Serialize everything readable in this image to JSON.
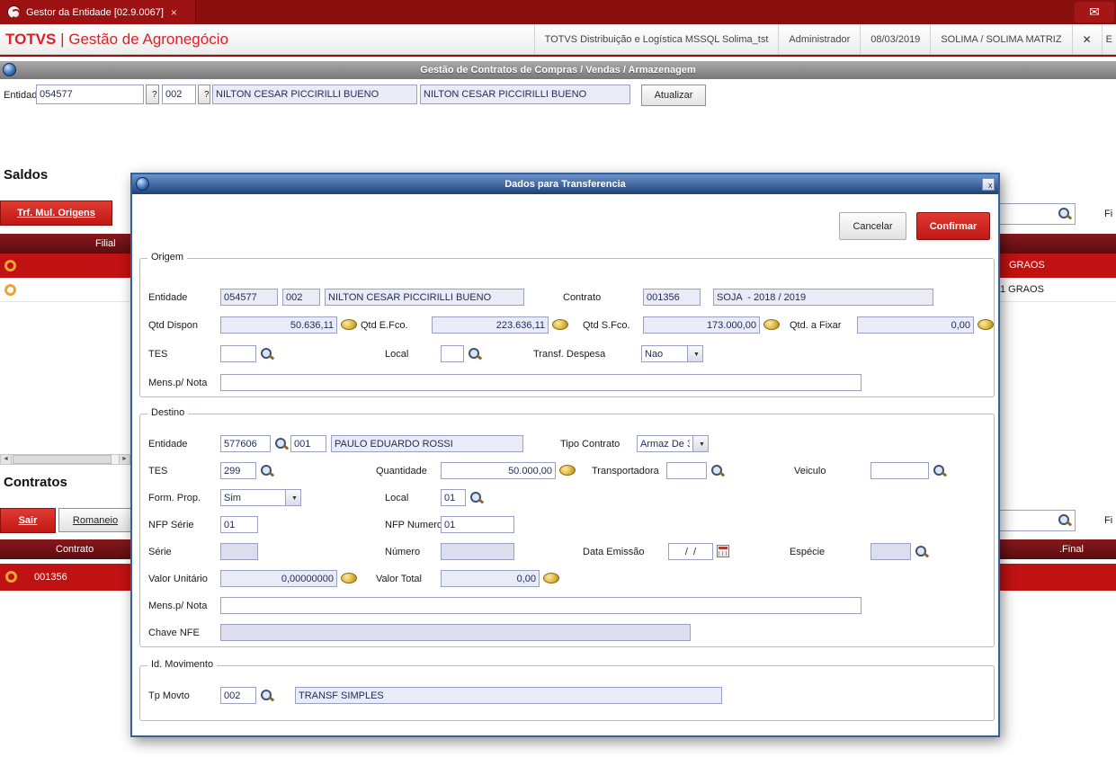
{
  "icons": {
    "mail": "✉",
    "tab_close": "×",
    "header_close": "✕",
    "dialog_close": "x",
    "dropdown": "▼",
    "scroll_left": "◄",
    "scroll_right": "►",
    "help": "?"
  },
  "topbar": {
    "tab_title": "Gestor da Entidade [02.9.0067]"
  },
  "header": {
    "brand": "TOTVS",
    "app": "| Gestão de Agronegócio",
    "env": "TOTVS Distribuição e Logística MSSQL Solima_tst",
    "user": "Administrador",
    "date": "08/03/2019",
    "company": "SOLIMA / SOLIMA MATRIZ",
    "cut": "E"
  },
  "page": {
    "title": "Gestão de Contratos de Compras / Vendas / Armazenagem",
    "entity": {
      "label": "Entidade",
      "code": "054577",
      "store": "002",
      "name1": "NILTON CESAR PICCIRILLI BUENO",
      "name2": "NILTON CESAR PICCIRILLI BUENO",
      "update": "Atualizar"
    },
    "saldos": {
      "heading": "Saldos",
      "trf_button": "Trf. Mul. Origens",
      "filter_label": "Fi",
      "col_filial": "Filial",
      "row1_text": "GRAOS",
      "row2_text": "1 GRAOS"
    },
    "contratos": {
      "heading": "Contratos",
      "sair_button": "Sair",
      "romaneio_button": "Romaneio",
      "filter_label": "Fi",
      "col_contrato": "Contrato",
      "col_final": ".Final",
      "row_code": "001356"
    }
  },
  "dialog": {
    "title": "Dados para Transferencia",
    "cancel": "Cancelar",
    "confirm": "Confirmar",
    "origem": {
      "legend": "Origem",
      "entidade_label": "Entidade",
      "entidade_code": "054577",
      "entidade_store": "002",
      "entidade_name": "NILTON CESAR PICCIRILLI BUENO",
      "contrato_label": "Contrato",
      "contrato_code": "001356",
      "contrato_desc": "SOJA  - 2018 / 2019",
      "qtd_dispon_label": "Qtd Dispon",
      "qtd_dispon": "50.636,11",
      "qtd_efco_label": "Qtd E.Fco.",
      "qtd_efco": "223.636,11",
      "qtd_sfco_label": "Qtd S.Fco.",
      "qtd_sfco": "173.000,00",
      "qtd_fixar_label": "Qtd. a Fixar",
      "qtd_fixar": "0,00",
      "tes_label": "TES",
      "tes": "",
      "local_label": "Local",
      "local": "",
      "transf_label": "Transf. Despesa",
      "transf": "Nao",
      "mens_label": "Mens.p/ Nota",
      "mens": ""
    },
    "destino": {
      "legend": "Destino",
      "entidade_label": "Entidade",
      "entidade_code": "577606",
      "entidade_store": "001",
      "entidade_name": "PAULO EDUARDO ROSSI",
      "tipo_label": "Tipo Contrato",
      "tipo": "Armaz De 3",
      "tes_label": "TES",
      "tes": "299",
      "quantidade_label": "Quantidade",
      "quantidade": "50.000,00",
      "transportadora_label": "Transportadora",
      "transportadora": "",
      "veiculo_label": "Veiculo",
      "veiculo": "",
      "form_prop_label": "Form. Prop.",
      "form_prop": "Sim",
      "local_label": "Local",
      "local": "01",
      "nfp_serie_label": "NFP Série",
      "nfp_serie": "01",
      "nfp_numero_label": "NFP Numero",
      "nfp_numero": "01",
      "serie_label": "Série",
      "serie": "",
      "numero_label": "Número",
      "numero": "",
      "data_emissao_label": "Data Emissão",
      "data_emissao": "/  /",
      "especie_label": "Espécie",
      "especie": "",
      "valor_unit_label": "Valor Unitário",
      "valor_unit": "0,00000000",
      "valor_total_label": "Valor Total",
      "valor_total": "0,00",
      "mens_label": "Mens.p/ Nota",
      "mens": "",
      "chave_label": "Chave NFE",
      "chave": ""
    },
    "movimento": {
      "legend": "Id. Movimento",
      "tp_movto_label": "Tp Movto",
      "tp_movto": "002",
      "tp_movto_desc": "TRANSF SIMPLES"
    }
  }
}
